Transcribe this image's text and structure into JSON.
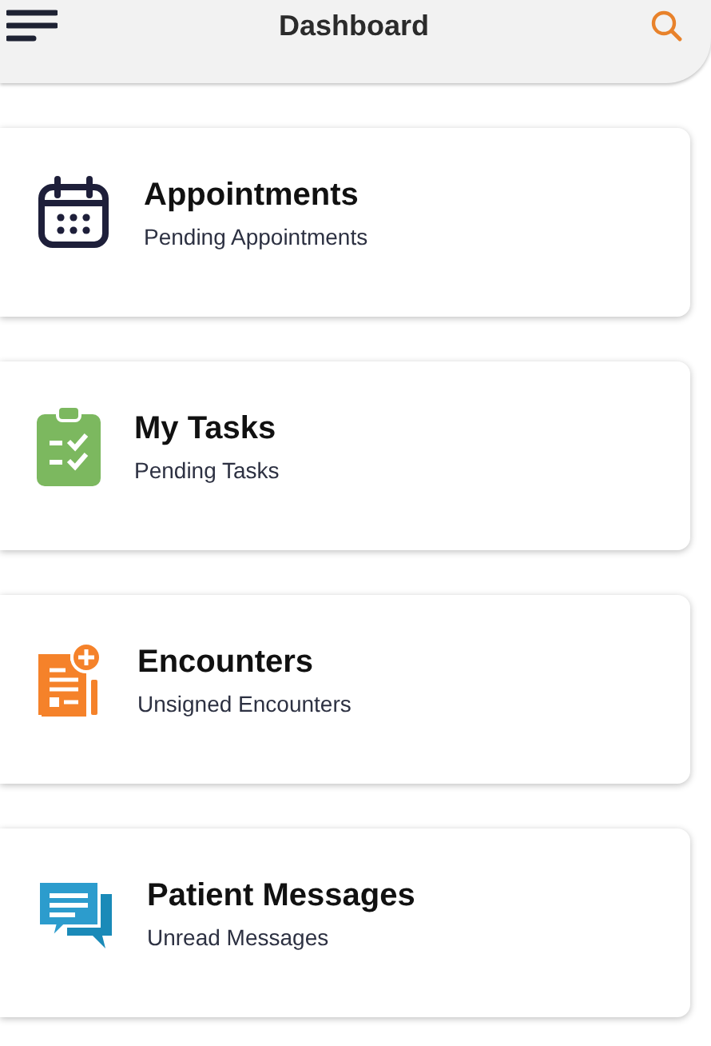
{
  "header": {
    "title": "Dashboard"
  },
  "cards": [
    {
      "kind": "calendar",
      "title": "Appointments",
      "subtitle": "Pending Appointments"
    },
    {
      "kind": "tasks",
      "title": "My Tasks",
      "subtitle": "Pending Tasks"
    },
    {
      "kind": "encounter",
      "title": "Encounters",
      "subtitle": "Unsigned Encounters"
    },
    {
      "kind": "messages",
      "title": "Patient Messages",
      "subtitle": "Unread Messages"
    }
  ]
}
